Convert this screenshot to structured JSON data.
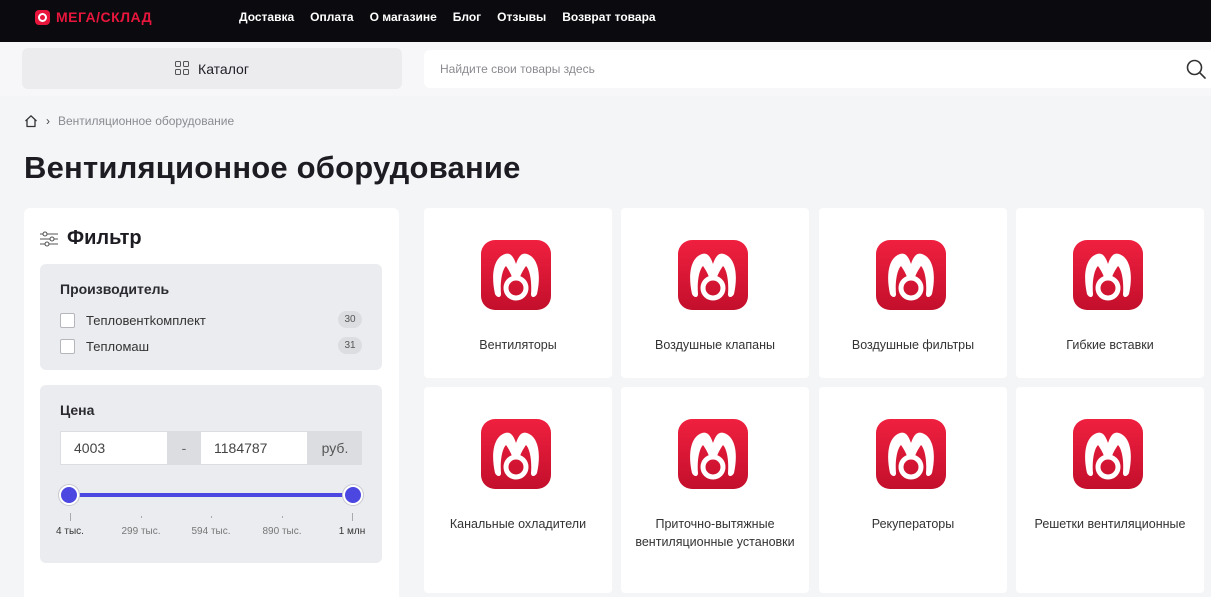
{
  "header": {
    "logo_text": "МЕГА/СКЛАД",
    "nav": [
      "Доставка",
      "Оплата",
      "О магазине",
      "Блог",
      "Отзывы",
      "Возврат товара"
    ]
  },
  "toolbar": {
    "catalog_label": "Каталог",
    "search_placeholder": "Найдите свои товары здесь"
  },
  "breadcrumb": {
    "current": "Вентиляционное оборудование"
  },
  "page_title": "Вентиляционное оборудование",
  "filter": {
    "title": "Фильтр",
    "manufacturer": {
      "title": "Производитель",
      "items": [
        {
          "label": "Тепловентkомплект",
          "count": "30"
        },
        {
          "label": "Тепломаш",
          "count": "31"
        }
      ]
    },
    "price": {
      "title": "Цена",
      "min_value": "4003",
      "max_value": "1184787",
      "separator": "-",
      "unit": "руб.",
      "range_fraction": [
        0,
        1
      ],
      "ticks": [
        "4 тыс.",
        "299 тыс.",
        "594 тыс.",
        "890 тыс.",
        "1 млн"
      ]
    }
  },
  "categories": [
    {
      "label": "Вентиляторы"
    },
    {
      "label": "Воздушные клапаны"
    },
    {
      "label": "Воздушные фильтры"
    },
    {
      "label": "Гибкие вставки"
    },
    {
      "label": "Канальные охладители"
    },
    {
      "label": "Приточно-вытяжные вентиляционные установки"
    },
    {
      "label": "Рекуператоры"
    },
    {
      "label": "Решетки вентиляционные"
    }
  ],
  "colors": {
    "brand_red": "#e8163d",
    "accent_blue": "#4b47e0",
    "topbar_bg": "#0b0b0f"
  },
  "icons": [
    "logo-icon",
    "catalog-grid-icon",
    "search-icon",
    "home-icon",
    "filter-sliders-icon",
    "brand-logo-icon"
  ]
}
